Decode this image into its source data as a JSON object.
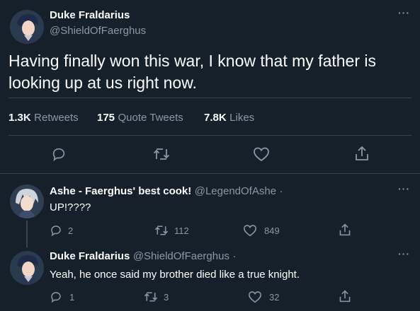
{
  "main_tweet": {
    "display_name": "Duke Fraldarius",
    "handle": "@ShieldOfFaerghus",
    "text": "Having finally won this war, I know that my father is looking up at us right now.",
    "more_label": "···",
    "stats": [
      {
        "value": "1.3K",
        "label": "Retweets"
      },
      {
        "value": "175",
        "label": "Quote Tweets"
      },
      {
        "value": "7.8K",
        "label": "Likes"
      }
    ],
    "actions": [
      "reply-icon",
      "retweet-icon",
      "like-icon",
      "share-icon"
    ]
  },
  "replies": [
    {
      "display_name": "Ashe - Faerghus' best cook!",
      "handle": "@LegendOfAshe",
      "separator": "·",
      "text": "UP!????",
      "more_label": "···",
      "reply_count": "2",
      "retweet_count": "112",
      "like_count": "849"
    },
    {
      "display_name": "Duke Fraldarius",
      "handle": "@ShieldOfFaerghus",
      "separator": "·",
      "text": "Yeah, he once said my brother died like a true knight.",
      "more_label": "···",
      "reply_count": "1",
      "retweet_count": "3",
      "like_count": "32"
    }
  ],
  "colors": {
    "background": "#15202b",
    "text": "#ffffff",
    "secondary": "#8b98a5",
    "divider": "#38444d"
  }
}
